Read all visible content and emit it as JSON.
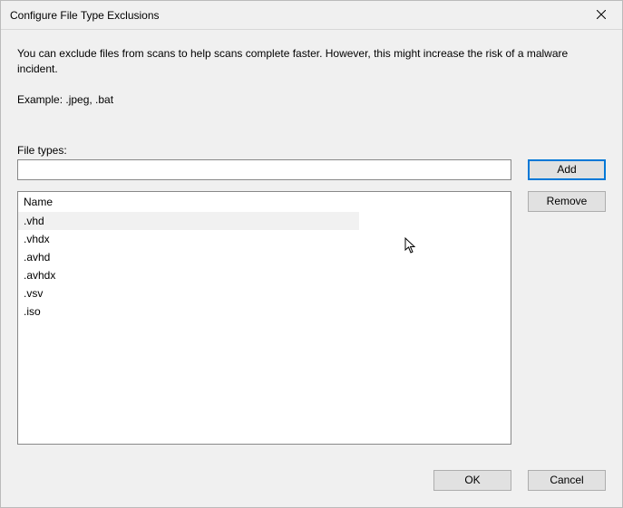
{
  "title": "Configure File Type Exclusions",
  "description": "You can exclude files from scans to help scans complete faster. However, this might increase the risk of a malware incident.",
  "example_label": "Example: .jpeg, .bat",
  "file_types_label": "File types:",
  "input_value": "",
  "buttons": {
    "add": "Add",
    "remove": "Remove",
    "ok": "OK",
    "cancel": "Cancel"
  },
  "list": {
    "header": "Name",
    "items": [
      {
        "label": ".vhd",
        "selected": true
      },
      {
        "label": ".vhdx",
        "selected": false
      },
      {
        "label": ".avhd",
        "selected": false
      },
      {
        "label": ".avhdx",
        "selected": false
      },
      {
        "label": ".vsv",
        "selected": false
      },
      {
        "label": ".iso",
        "selected": false
      }
    ]
  }
}
